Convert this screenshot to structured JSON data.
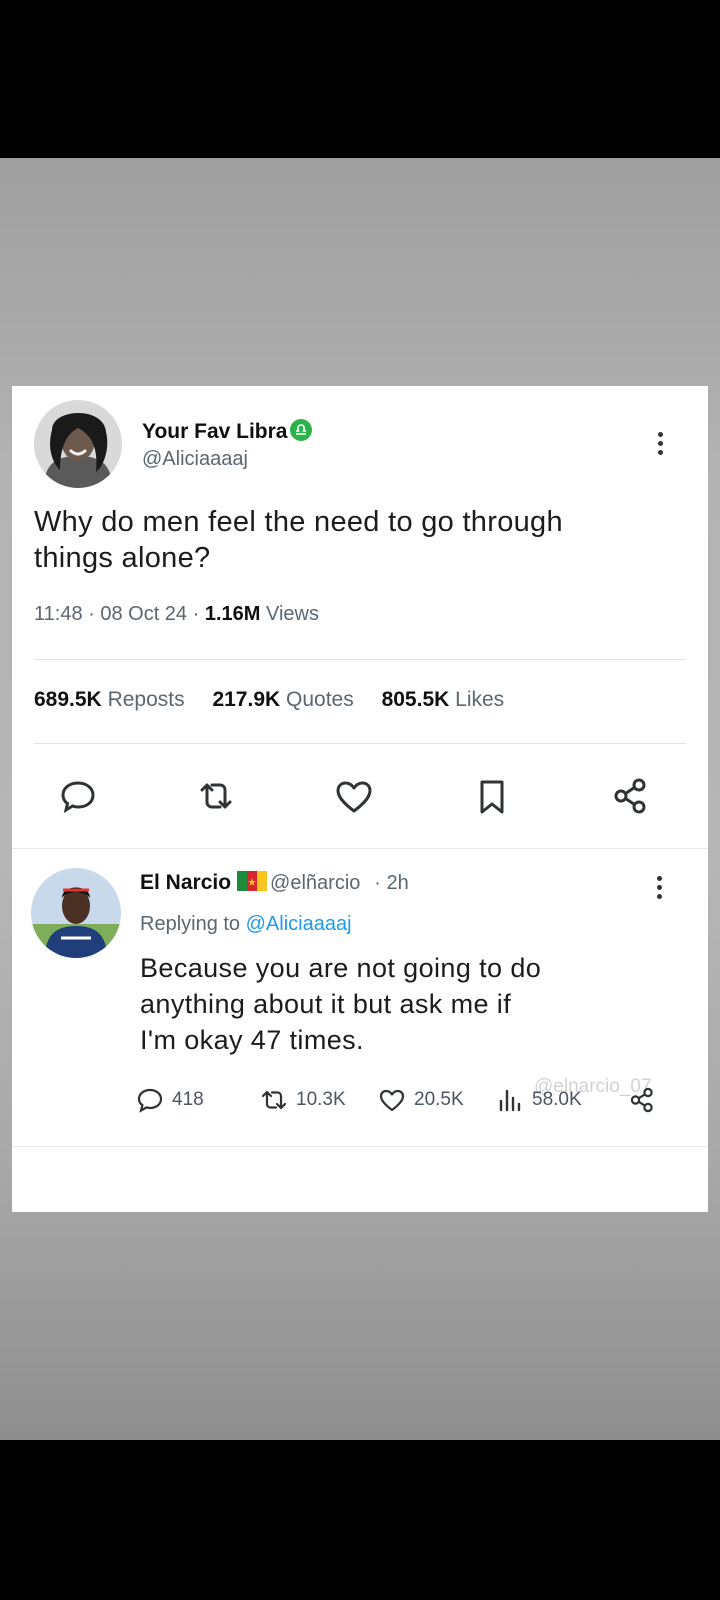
{
  "tweet": {
    "display_name": "Your Fav Libra",
    "name_emoji_icon": "libra-zodiac-icon",
    "handle": "@Aliciaaaaj",
    "text_line1": "Why do men feel the need to go through",
    "text_line2": "things alone?",
    "time": "11:48 · 08 Oct 24 · ",
    "views_count": "1.16M",
    "views_label": " Views",
    "reposts_count": "689.5K",
    "reposts_label": "Reposts",
    "quotes_count": "217.9K",
    "quotes_label": "Quotes",
    "likes_count": "805.5K",
    "likes_label": "Likes",
    "actions": [
      "reply-icon",
      "repost-icon",
      "heart-icon",
      "bookmark-icon",
      "share-icon"
    ]
  },
  "reply": {
    "display_name": "El Narcio",
    "flag_icon": "cameroon-flag-icon",
    "handle": "@elñarcio",
    "age": "· 2h",
    "replying_prefix": "Replying to ",
    "replying_to": "@Aliciaaaaj",
    "text_line1": "Because you are not going to do",
    "text_line2": "anything about it but ask me if",
    "text_line3": "I'm okay 47 times.",
    "replies": "418",
    "reposts": "10.3K",
    "likes": "20.5K",
    "views": "58.0K",
    "watermark": "@elnarcio_07"
  },
  "colors": {
    "link": "#1d9bf0",
    "libra_badge": "#2bb34a",
    "background_frame": "#000000"
  }
}
